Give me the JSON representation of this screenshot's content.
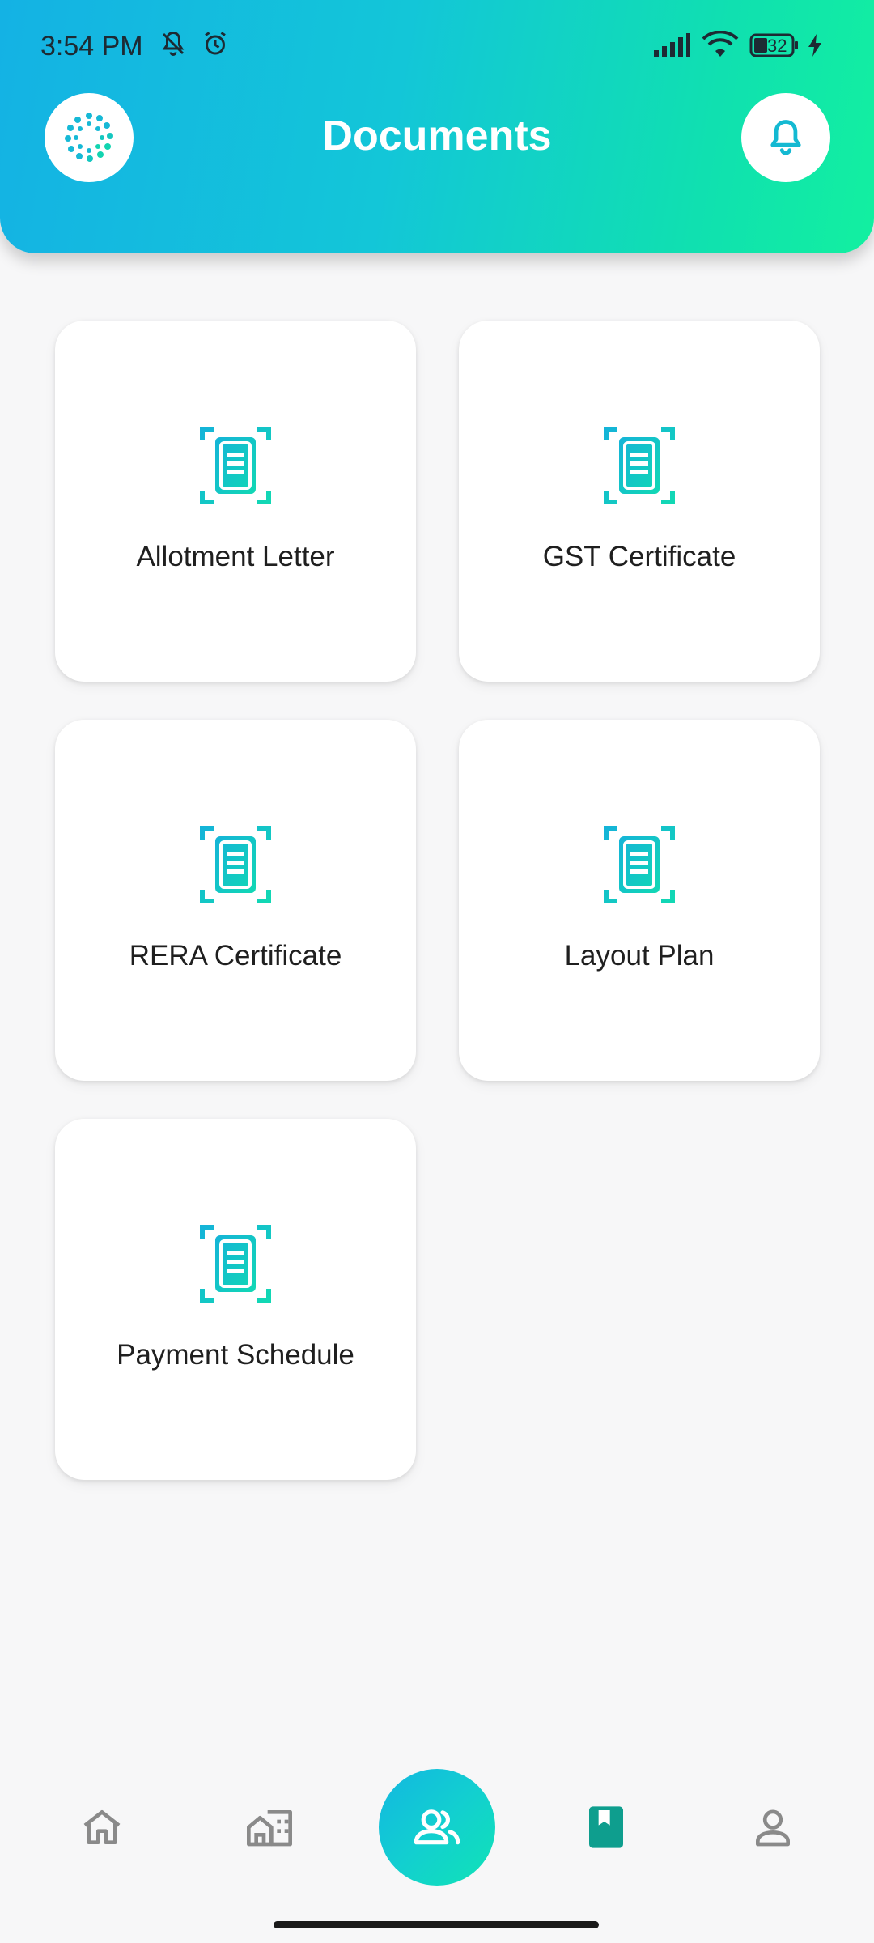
{
  "status_bar": {
    "time": "3:54 PM",
    "battery": "32"
  },
  "header": {
    "title": "Documents"
  },
  "documents": [
    {
      "label": "Allotment Letter"
    },
    {
      "label": "GST Certificate"
    },
    {
      "label": "RERA Certificate"
    },
    {
      "label": "Layout Plan"
    },
    {
      "label": "Payment Schedule"
    }
  ],
  "bottom_nav": {
    "items": [
      {
        "icon": "home-icon"
      },
      {
        "icon": "buildings-icon"
      },
      {
        "icon": "users-icon"
      },
      {
        "icon": "book-icon"
      },
      {
        "icon": "profile-icon"
      }
    ],
    "active_index": 2
  },
  "colors": {
    "accent_start": "#14b2e4",
    "accent_end": "#12f0a0",
    "icon_teal": "#12c8c4",
    "nav_active_book": "#0e9e8e",
    "nav_inactive": "#8a8a8a"
  }
}
